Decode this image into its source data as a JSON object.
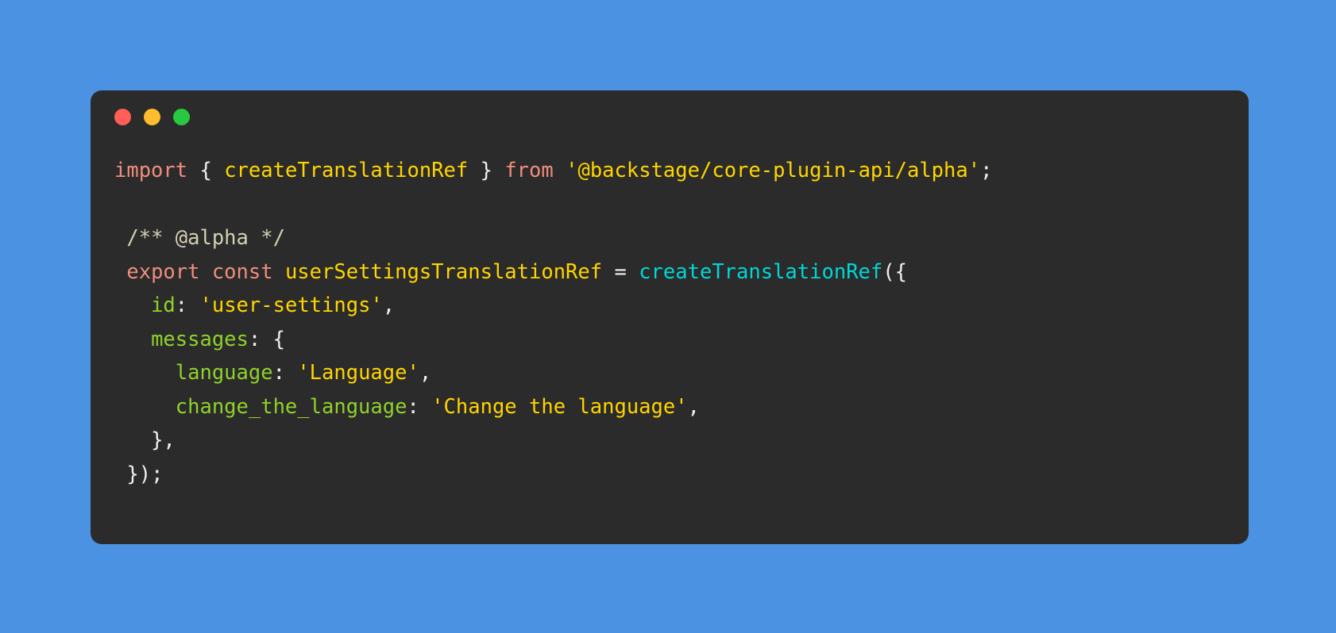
{
  "window": {
    "background_color": "#4c92e2",
    "panel_color": "#2b2b2b",
    "traffic_lights": [
      {
        "name": "close",
        "color": "#ff5f57"
      },
      {
        "name": "minimize",
        "color": "#febc2e"
      },
      {
        "name": "maximize",
        "color": "#28c840"
      }
    ]
  },
  "theme": {
    "keyword": "#f08d7c",
    "string": "#ffd500",
    "function": "#00d7d7",
    "property": "#8fd22a",
    "comment": "#d3d0b2",
    "punctuation": "#f0f0f0"
  },
  "code": {
    "language": "typescript",
    "full_text": "import { createTranslationRef } from '@backstage/core-plugin-api/alpha';\n\n/** @alpha */\nexport const userSettingsTranslationRef = createTranslationRef({\n  id: 'user-settings',\n  messages: {\n    language: 'Language',\n    change_the_language: 'Change the language',\n  },\n});",
    "lines": [
      {
        "index": 1,
        "tokens": [
          {
            "t": "import",
            "c": "kw"
          },
          {
            "t": " ",
            "c": "plain"
          },
          {
            "t": "{",
            "c": "punc"
          },
          {
            "t": " ",
            "c": "plain"
          },
          {
            "t": "createTranslationRef",
            "c": "str"
          },
          {
            "t": " ",
            "c": "plain"
          },
          {
            "t": "}",
            "c": "punc"
          },
          {
            "t": " ",
            "c": "plain"
          },
          {
            "t": "from",
            "c": "kw"
          },
          {
            "t": " ",
            "c": "plain"
          },
          {
            "t": "'@backstage/core-plugin-api/alpha'",
            "c": "str"
          },
          {
            "t": ";",
            "c": "punc"
          }
        ]
      },
      {
        "index": 2,
        "tokens": []
      },
      {
        "index": 3,
        "tokens": [
          {
            "t": " ",
            "c": "plain"
          },
          {
            "t": "/** @alpha */",
            "c": "cmt"
          }
        ]
      },
      {
        "index": 4,
        "tokens": [
          {
            "t": " ",
            "c": "plain"
          },
          {
            "t": "export const",
            "c": "kw"
          },
          {
            "t": " ",
            "c": "plain"
          },
          {
            "t": "userSettingsTranslationRef",
            "c": "str"
          },
          {
            "t": " ",
            "c": "plain"
          },
          {
            "t": "=",
            "c": "punc"
          },
          {
            "t": " ",
            "c": "plain"
          },
          {
            "t": "createTranslationRef",
            "c": "fn"
          },
          {
            "t": "({",
            "c": "punc"
          }
        ]
      },
      {
        "index": 5,
        "tokens": [
          {
            "t": "   ",
            "c": "plain"
          },
          {
            "t": "id",
            "c": "prop"
          },
          {
            "t": ": ",
            "c": "punc"
          },
          {
            "t": "'user-settings'",
            "c": "str"
          },
          {
            "t": ",",
            "c": "punc"
          }
        ]
      },
      {
        "index": 6,
        "tokens": [
          {
            "t": "   ",
            "c": "plain"
          },
          {
            "t": "messages",
            "c": "prop"
          },
          {
            "t": ": ",
            "c": "punc"
          },
          {
            "t": "{",
            "c": "punc"
          }
        ]
      },
      {
        "index": 7,
        "tokens": [
          {
            "t": "     ",
            "c": "plain"
          },
          {
            "t": "language",
            "c": "prop"
          },
          {
            "t": ": ",
            "c": "punc"
          },
          {
            "t": "'Language'",
            "c": "str"
          },
          {
            "t": ",",
            "c": "punc"
          }
        ]
      },
      {
        "index": 8,
        "tokens": [
          {
            "t": "     ",
            "c": "plain"
          },
          {
            "t": "change_the_language",
            "c": "prop"
          },
          {
            "t": ": ",
            "c": "punc"
          },
          {
            "t": "'Change the language'",
            "c": "str"
          },
          {
            "t": ",",
            "c": "punc"
          }
        ]
      },
      {
        "index": 9,
        "tokens": [
          {
            "t": "   ",
            "c": "plain"
          },
          {
            "t": "},",
            "c": "punc"
          }
        ]
      },
      {
        "index": 10,
        "tokens": [
          {
            "t": " ",
            "c": "plain"
          },
          {
            "t": "});",
            "c": "punc"
          }
        ]
      }
    ]
  }
}
